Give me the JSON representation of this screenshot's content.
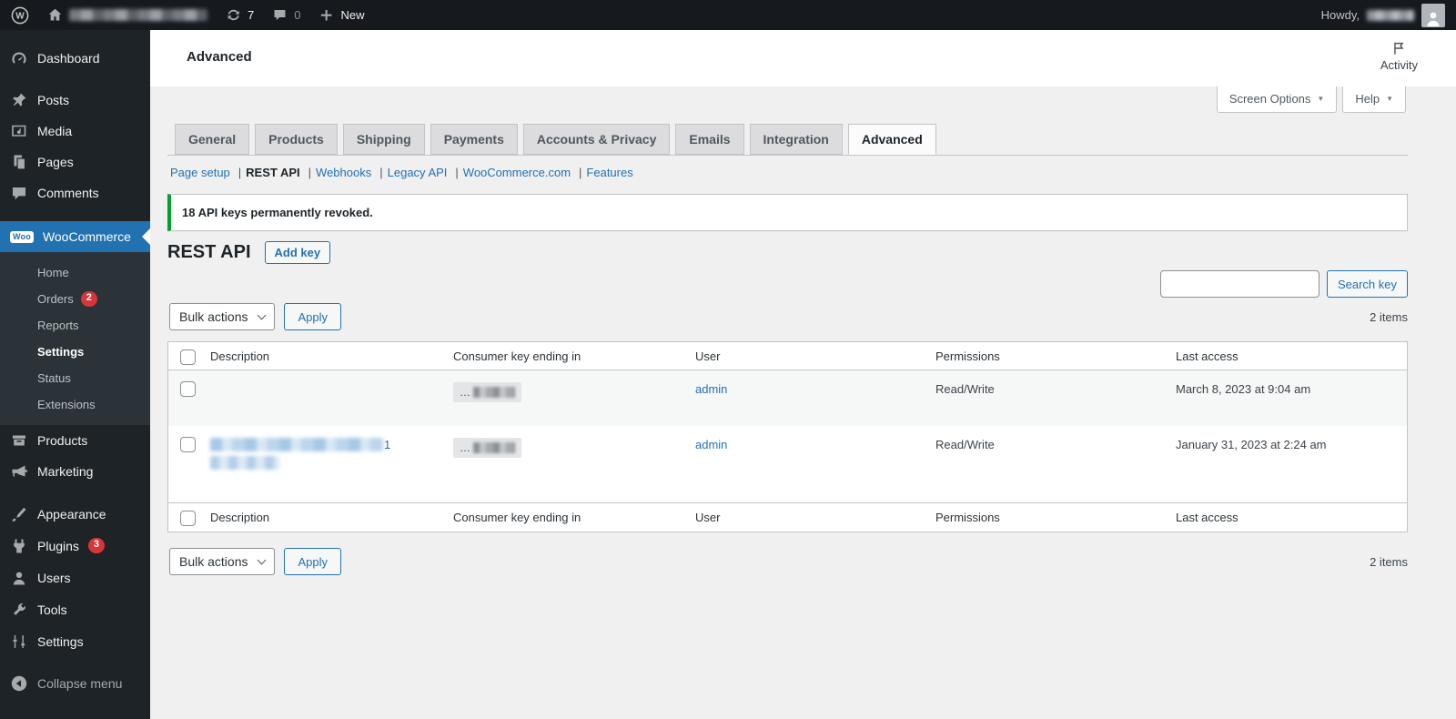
{
  "admin_bar": {
    "updates_count": "7",
    "comments_count": "0",
    "new_label": "New",
    "howdy_label": "Howdy,"
  },
  "header": {
    "page_title": "Advanced",
    "activity_label": "Activity"
  },
  "screen_meta": {
    "screen_options_label": "Screen Options",
    "help_label": "Help"
  },
  "icons": {
    "dropdown_arrow": "▼"
  },
  "tabs": [
    {
      "label": "General"
    },
    {
      "label": "Products"
    },
    {
      "label": "Shipping"
    },
    {
      "label": "Payments"
    },
    {
      "label": "Accounts & Privacy"
    },
    {
      "label": "Emails"
    },
    {
      "label": "Integration"
    },
    {
      "label": "Advanced",
      "active": true
    }
  ],
  "subnav": {
    "separator": "|",
    "items": [
      {
        "label": "Page setup"
      },
      {
        "label": "REST API",
        "current": true
      },
      {
        "label": "Webhooks"
      },
      {
        "label": "Legacy API"
      },
      {
        "label": "WooCommerce.com"
      },
      {
        "label": "Features"
      }
    ]
  },
  "notice": {
    "message": "18 API keys permanently revoked."
  },
  "rest_api": {
    "heading": "REST API",
    "add_key_label": "Add key",
    "search_button_label": "Search key",
    "search_value": ""
  },
  "list": {
    "bulk_actions_label": "Bulk actions",
    "apply_label": "Apply",
    "items_count": "2 items",
    "columns": [
      "Description",
      "Consumer key ending in",
      "User",
      "Permissions",
      "Last access"
    ],
    "rows": [
      {
        "key_prefix": "…",
        "user": "admin",
        "permissions": "Read/Write",
        "last_access": "March 8, 2023 at 9:04 am"
      },
      {
        "key_prefix": "…",
        "description_suffix": "1",
        "user": "admin",
        "permissions": "Read/Write",
        "last_access": "January 31, 2023 at 2:24 am"
      }
    ]
  },
  "sidebar": {
    "dashboard": "Dashboard",
    "posts": "Posts",
    "media": "Media",
    "pages": "Pages",
    "comments": "Comments",
    "woocommerce": "WooCommerce",
    "woo_logo_text": "Woo",
    "submenu": {
      "home": "Home",
      "orders": "Orders",
      "orders_badge": "2",
      "reports": "Reports",
      "settings": "Settings",
      "status": "Status",
      "extensions": "Extensions"
    },
    "products": "Products",
    "marketing": "Marketing",
    "appearance": "Appearance",
    "plugins": "Plugins",
    "plugins_badge": "3",
    "users": "Users",
    "tools": "Tools",
    "settings": "Settings",
    "collapse": "Collapse menu"
  },
  "colors": {
    "accent_blue": "#2271b1",
    "badge_red": "#d63638",
    "notice_green": "#00a32a",
    "sidebar_bg": "#1d2327",
    "content_bg": "#f0f0f1"
  }
}
